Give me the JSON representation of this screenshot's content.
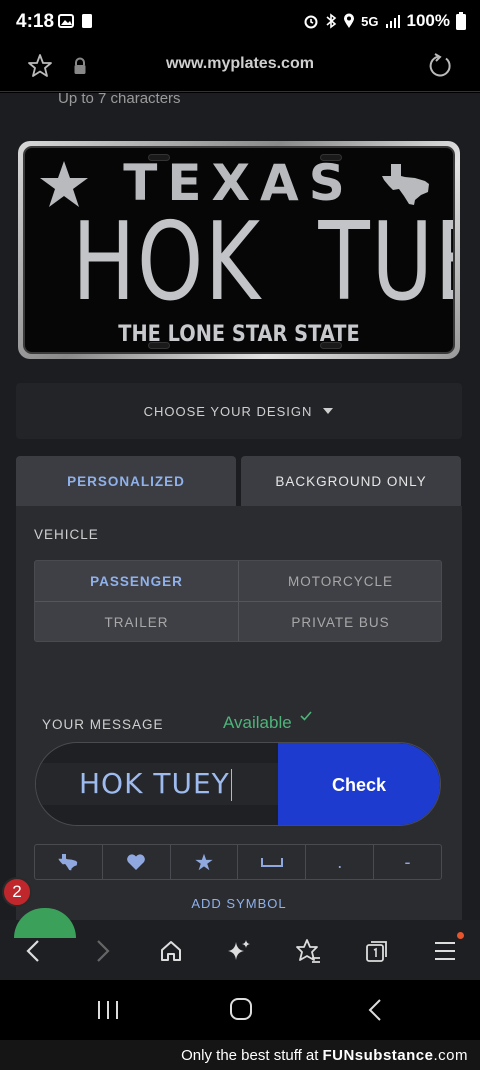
{
  "status": {
    "time": "4:18",
    "network": "5G",
    "battery": "100%"
  },
  "browser": {
    "url": "www.myplates.com"
  },
  "page": {
    "hint": "Up to 7 characters",
    "plate": {
      "state": "TEXAS",
      "text": "HOK  TUEY",
      "slogan": "THE LONE STAR STATE"
    },
    "design_selector": "CHOOSE YOUR DESIGN",
    "tabs": [
      {
        "label": "PERSONALIZED",
        "active": true
      },
      {
        "label": "BACKGROUND ONLY",
        "active": false
      }
    ],
    "vehicle": {
      "label": "VEHICLE",
      "options": [
        {
          "label": "PASSENGER",
          "active": true
        },
        {
          "label": "MOTORCYCLE",
          "active": false
        },
        {
          "label": "TRAILER",
          "active": false
        },
        {
          "label": "PRIVATE BUS",
          "active": false
        }
      ]
    },
    "message": {
      "label": "YOUR MESSAGE",
      "availability": "Available",
      "value": "HOK TUEY",
      "check_label": "Check"
    },
    "symbols": [
      "texas-shape-icon",
      "heart-icon",
      "star-icon",
      "space-icon",
      "dot-icon",
      "dash-icon"
    ],
    "symbol_glyphs": {
      "dot": ".",
      "dash": "-"
    },
    "add_symbol": "ADD SYMBOL"
  },
  "notification_badge": "2",
  "footer": {
    "text": "Only the best stuff at",
    "brand": "FUNsubstance",
    "domain": ".com"
  },
  "colors": {
    "accent_blue": "#1e3bd0",
    "link_blue": "#8fb1ec",
    "available_green": "#4fb37a",
    "page_bg": "#1c1d21"
  }
}
